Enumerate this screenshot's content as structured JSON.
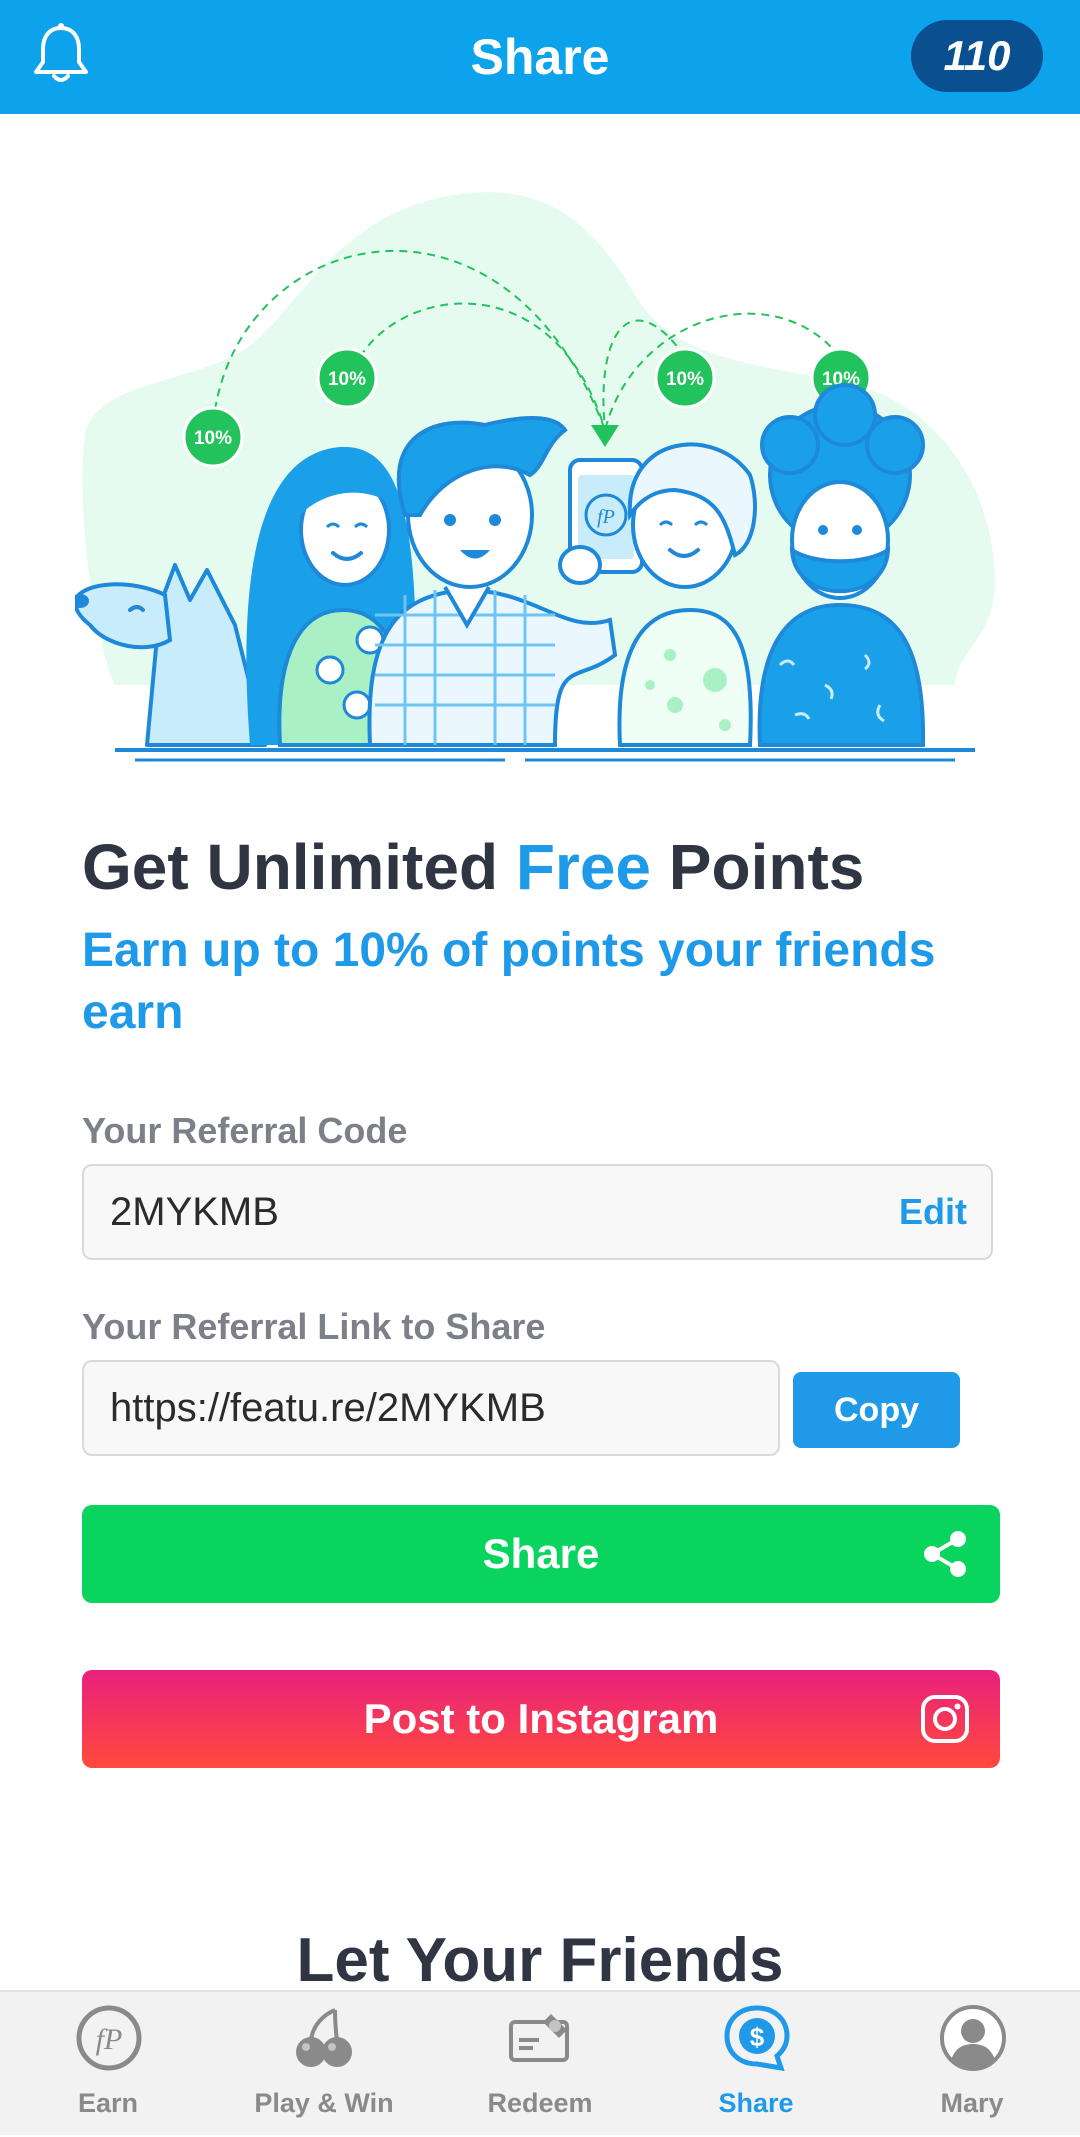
{
  "header": {
    "title": "Share",
    "points": "110",
    "bell_icon": "bell-icon"
  },
  "hero": {
    "badges": [
      "10%",
      "10%",
      "10%",
      "10%"
    ],
    "phone_logo": "fP"
  },
  "headline": {
    "part1": "Get Unlimited ",
    "accent": "Free",
    "part2": " Points"
  },
  "subhead": "Earn up to 10% of points your friends earn",
  "referral_code": {
    "label": "Your Referral Code",
    "value": "2MYKMB",
    "edit_label": "Edit"
  },
  "referral_link": {
    "label": "Your Referral Link to Share",
    "value": "https://featu.re/2MYKMB",
    "copy_label": "Copy"
  },
  "buttons": {
    "share_label": "Share",
    "share_icon": "share-icon",
    "instagram_label": "Post to Instagram",
    "instagram_icon": "instagram-icon"
  },
  "friends_heading": "Let Your Friends",
  "nav": {
    "items": [
      {
        "label": "Earn",
        "icon": "fp-logo-icon"
      },
      {
        "label": "Play & Win",
        "icon": "cherries-icon"
      },
      {
        "label": "Redeem",
        "icon": "gift-card-icon"
      },
      {
        "label": "Share",
        "icon": "dollar-chat-icon",
        "active": true
      },
      {
        "label": "Mary",
        "icon": "profile-icon"
      }
    ]
  },
  "colors": {
    "header_bg": "#0da2ec",
    "accent_blue": "#1e9ae8",
    "share_green": "#08d45e",
    "instagram_pink": "#e8217e",
    "instagram_orange": "#ff4a3b"
  }
}
